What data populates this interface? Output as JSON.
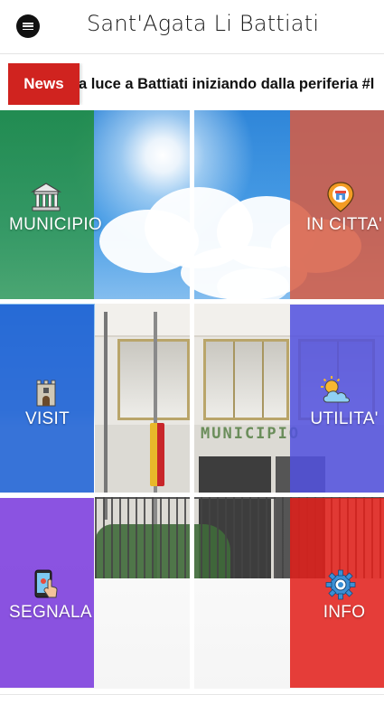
{
  "header": {
    "title": "Sant'Agata Li Battiati",
    "menu_icon": "hamburger-menu-icon"
  },
  "news": {
    "badge": "News",
    "ticker": "a luce a Battiati iniziando dalla periferia #l",
    "badge_color": "#d0231f"
  },
  "photo": {
    "sign_text": "MUNICIPIO"
  },
  "tiles": [
    {
      "label": "MUNICIPIO",
      "icon": "town-hall-icon",
      "color": "#208c46"
    },
    {
      "label": "IN CITTA'",
      "icon": "map-pin-shop-icon",
      "color": "#d65c44"
    },
    {
      "label": "VISIT",
      "icon": "castle-tower-icon",
      "color": "#165cd2"
    },
    {
      "label": "UTILITA'",
      "icon": "sun-cloud-icon",
      "color": "#5250de"
    },
    {
      "label": "SEGNALA",
      "icon": "touch-phone-icon",
      "color": "#7837dc"
    },
    {
      "label": "INFO",
      "icon": "gear-icon",
      "color": "#e21e1a"
    }
  ]
}
